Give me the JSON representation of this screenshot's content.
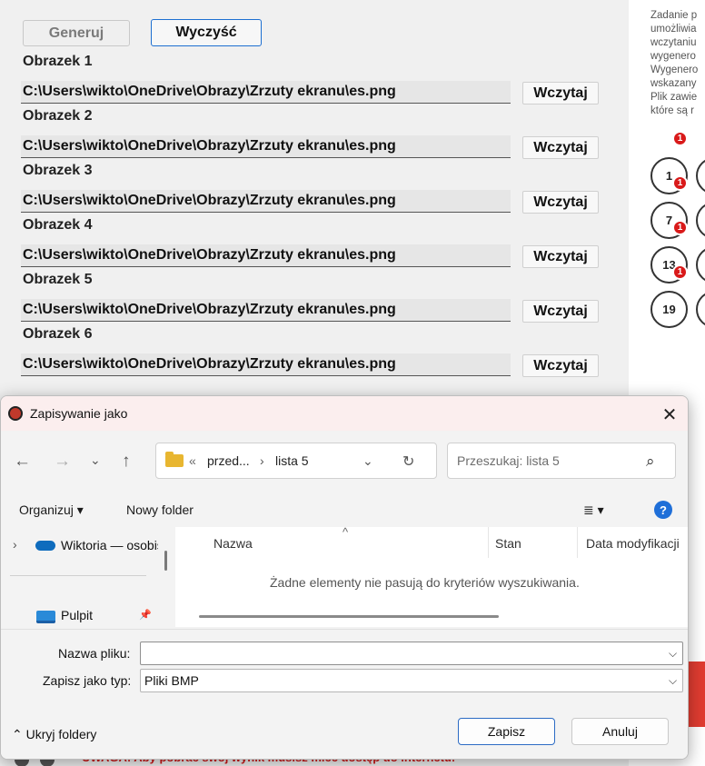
{
  "app": {
    "generate_label": "Generuj",
    "clear_label": "Wyczyść",
    "load_label": "Wczytaj",
    "images": [
      {
        "label": "Obrazek 1",
        "path": "C:\\Users\\wikto\\OneDrive\\Obrazy\\Zrzuty ekranu\\es.png"
      },
      {
        "label": "Obrazek 2",
        "path": "C:\\Users\\wikto\\OneDrive\\Obrazy\\Zrzuty ekranu\\es.png"
      },
      {
        "label": "Obrazek 3",
        "path": "C:\\Users\\wikto\\OneDrive\\Obrazy\\Zrzuty ekranu\\es.png"
      },
      {
        "label": "Obrazek 4",
        "path": "C:\\Users\\wikto\\OneDrive\\Obrazy\\Zrzuty ekranu\\es.png"
      },
      {
        "label": "Obrazek 5",
        "path": "C:\\Users\\wikto\\OneDrive\\Obrazy\\Zrzuty ekranu\\es.png"
      },
      {
        "label": "Obrazek 6",
        "path": "C:\\Users\\wikto\\OneDrive\\Obrazy\\Zrzuty ekranu\\es.png"
      }
    ]
  },
  "info_panel": {
    "lines": [
      "Zadanie p",
      "umożliwia",
      "wczytaniu",
      "wygenero",
      "Wygenero",
      "wskazany",
      "Plik zawie",
      "które są r"
    ],
    "numbers": [
      "1",
      "7",
      "13",
      "19"
    ],
    "badge": "1",
    "warning": "UWAGA: Aby pobrać swój wynik musisz mieć dostęp do internetu!"
  },
  "dialog": {
    "title": "Zapisywanie jako",
    "close_glyph": "✕",
    "nav": {
      "back": "←",
      "forward": "→",
      "recent": "⌄",
      "up": "↑"
    },
    "breadcrumb": {
      "overflow": "«",
      "parent": "przed...",
      "separator": "›",
      "current": "lista 5",
      "dropdown": "⌄",
      "refresh": "↻"
    },
    "search_placeholder": "Przeszukaj: lista 5",
    "search_glyph": "⌕",
    "toolbar": {
      "organize": "Organizuj ▾",
      "new_folder": "Nowy folder",
      "view": "≣ ▾",
      "help": "?"
    },
    "nav_pane": [
      {
        "label": "Wiktoria — osobiste",
        "icon": "onedrive-icon",
        "expander": "›"
      },
      {
        "label": "Pulpit",
        "icon": "desktop-icon",
        "pin": "📌"
      }
    ],
    "columns": [
      "Nazwa",
      "Stan",
      "Data modyfikacji"
    ],
    "sort_glyph": "^",
    "empty_message": "Żadne elementy nie pasują do kryteriów wyszukiwania.",
    "filename_label": "Nazwa pliku:",
    "filename_value": "",
    "filetype_label": "Zapisz jako typ:",
    "filetype_value": "Pliki BMP",
    "chevron": "⌵",
    "hide_folders": "⌃  Ukryj foldery",
    "save": "Zapisz",
    "cancel": "Anuluj"
  },
  "colors": {
    "accent": "#1d6fd1",
    "badge": "#d91a1a",
    "warning": "#d01818",
    "folder": "#e8b630",
    "onedrive": "#0f6cbd"
  }
}
